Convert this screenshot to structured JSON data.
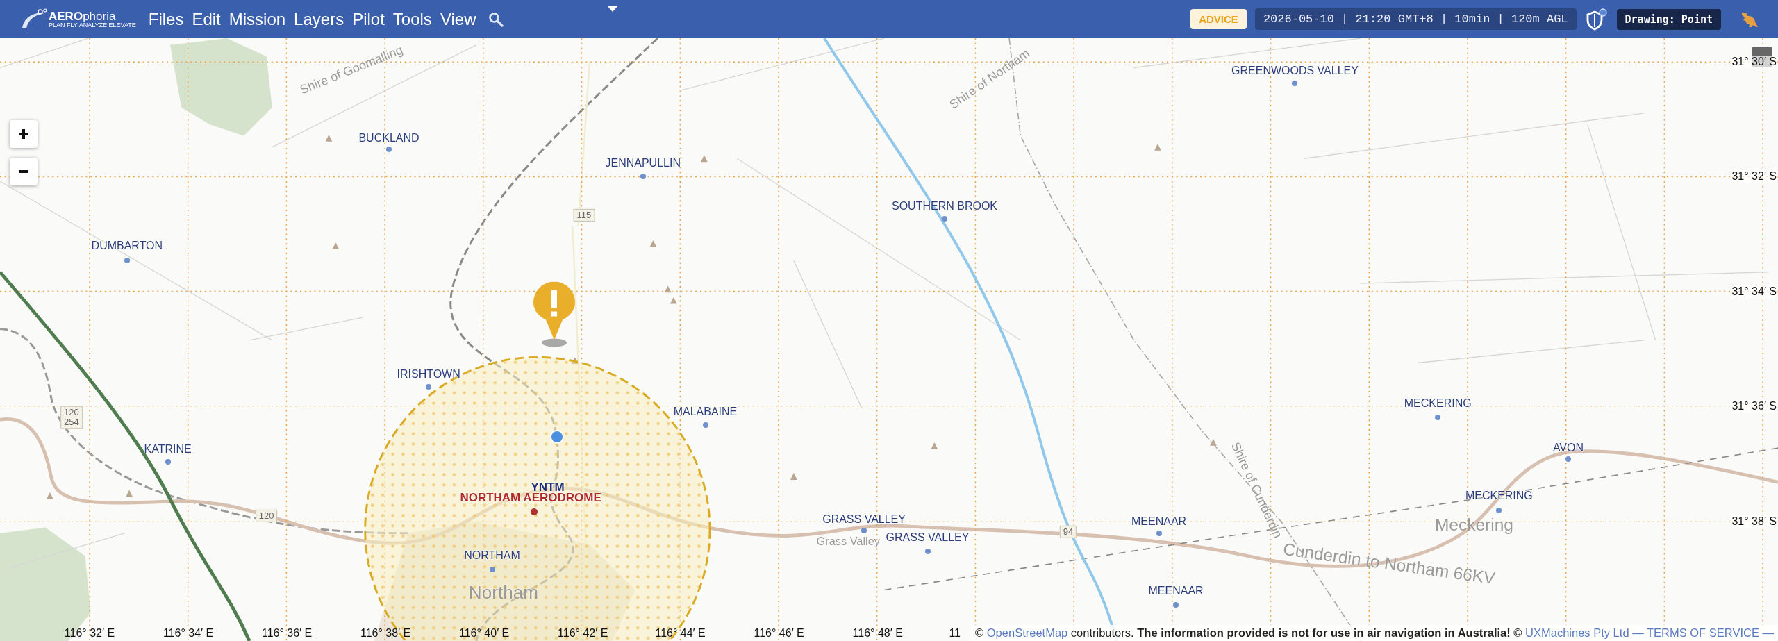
{
  "header": {
    "logo": {
      "name": "**AERO**phoria",
      "tagline": "PLAN FLY ANALYZE ELEVATE"
    },
    "menu": [
      {
        "label": "Files"
      },
      {
        "label": "Edit"
      },
      {
        "label": "Mission"
      },
      {
        "label": "Layers"
      },
      {
        "label": "Pilot"
      },
      {
        "label": "Tools"
      },
      {
        "label": "View"
      }
    ],
    "advice": "ADVICE",
    "flight_info": "2026-05-10 | 21:20 GMT+8 | 10min | 120m AGL",
    "mode": "Drawing: Point"
  },
  "map": {
    "places": [
      {
        "name": "GREENWOODS VALLEY"
      },
      {
        "name": "BUCKLAND"
      },
      {
        "name": "JENNAPULLIN"
      },
      {
        "name": "SOUTHERN BROOK"
      },
      {
        "name": "DUMBARTON"
      },
      {
        "name": "IRISHTOWN"
      },
      {
        "name": "MECKERING"
      },
      {
        "name": "MALABAINE"
      },
      {
        "name": "AVON"
      },
      {
        "name": "KATRINE"
      },
      {
        "name": "MECKERING"
      },
      {
        "name": "GRASS VALLEY"
      },
      {
        "name": "MEENAAR"
      },
      {
        "name": "GRASS VALLEY"
      },
      {
        "name": "NORTHAM"
      },
      {
        "name": "MEENAAR"
      }
    ],
    "aerodrome": {
      "code": "YNTM",
      "name": "NORTHAM AERODROME"
    },
    "tile_labels": [
      {
        "text": "Shire of Goomalling"
      },
      {
        "text": "Shire of Northam"
      },
      {
        "text": "Shire of Cunderdin"
      },
      {
        "text": "Cunderdin to Northam 66KV"
      },
      {
        "text": "Grass Valley"
      },
      {
        "text": "Northam"
      },
      {
        "text": "Meckering"
      }
    ],
    "road_shields": [
      {
        "text": "115"
      },
      {
        "text": "120\n254"
      },
      {
        "text": "120"
      },
      {
        "text": "94"
      }
    ],
    "lat_labels": [
      "31° 30′ S",
      "31° 32′ S",
      "31° 34′ S",
      "31° 36′ S",
      "31° 38′ S"
    ],
    "lon_labels": [
      "116° 32′ E",
      "116° 34′ E",
      "116° 36′ E",
      "116° 38′ E",
      "116° 40′ E",
      "116° 42′ E",
      "116° 44′ E",
      "116° 46′ E",
      "116° 48′ E",
      "11"
    ],
    "attribution": {
      "osm_mark": "©",
      "company_mark": "©",
      "osm": "OpenStreetMap",
      "contributors": " contributors. ",
      "warning": "The information provided is not for use in air navigation in Australia!",
      "company": "UXMachines Pty Ltd",
      "tos": "— TERMS OF SERVICE —"
    }
  }
}
